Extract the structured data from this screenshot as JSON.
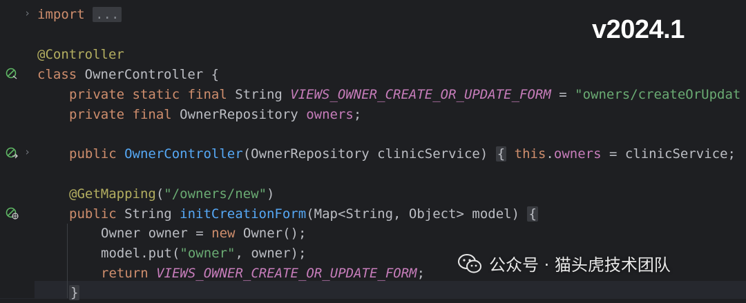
{
  "version_label": "v2024.1",
  "watermark": {
    "icon": "wechat-icon",
    "text": "公众号 · 猫头虎技术团队"
  },
  "colors": {
    "background": "#1e1f22",
    "keyword": "#cf8e6d",
    "annotation": "#b3ae60",
    "string": "#6aab73",
    "field": "#c77dbb",
    "method": "#56a8f5",
    "text": "#bcbec4"
  },
  "code": {
    "l1": {
      "kw": "import",
      "fold": "..."
    },
    "l3": {
      "ann": "@Controller"
    },
    "l4": {
      "kw": "class",
      "rest": " OwnerController {"
    },
    "l5": {
      "kw": "private static final",
      "type": " String ",
      "const": "VIEWS_OWNER_CREATE_OR_UPDATE_FORM",
      "eq": " = ",
      "str": "\"owners/createOrUpdat"
    },
    "l6": {
      "kw": "private final",
      "type": " OwnerRepository ",
      "field": "owners",
      "semi": ";"
    },
    "l8": {
      "kw": "public",
      "sp": " ",
      "fn": "OwnerController",
      "params": "(OwnerRepository clinicService)",
      "ob": "{",
      "this": "this",
      "dot": ".",
      "field": "owners",
      "rest": " = clinicService;"
    },
    "l10": {
      "ann": "@GetMapping",
      "open": "(",
      "str": "\"/owners/new\"",
      "close": ")"
    },
    "l11": {
      "kw": "public",
      "type": " String ",
      "fn": "initCreationForm",
      "params": "(Map<String, Object> model) ",
      "ob": "{"
    },
    "l12": {
      "type": "Owner owner = ",
      "kw": "new",
      "rest": " Owner();"
    },
    "l13": {
      "pre": "model.put(",
      "str": "\"owner\"",
      "rest": ", owner);"
    },
    "l14": {
      "kw": "return",
      "sp": " ",
      "const": "VIEWS_OWNER_CREATE_OR_UPDATE_FORM",
      "semi": ";"
    },
    "l15": {
      "cb": "}"
    }
  }
}
